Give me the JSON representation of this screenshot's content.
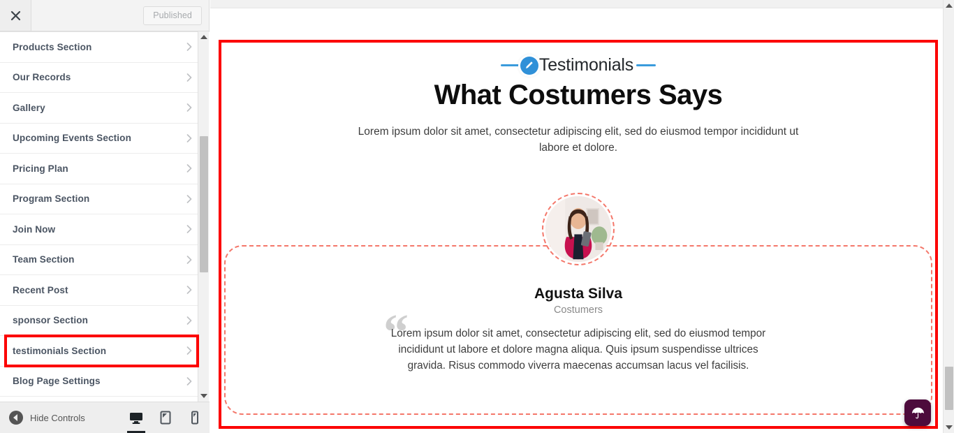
{
  "customizer": {
    "close_label": "Close",
    "publish_label": "Published",
    "sections": [
      {
        "label": "Products Section",
        "marked": false
      },
      {
        "label": "Our Records",
        "marked": false
      },
      {
        "label": "Gallery",
        "marked": false
      },
      {
        "label": "Upcoming Events Section",
        "marked": false
      },
      {
        "label": "Pricing Plan",
        "marked": false
      },
      {
        "label": "Program Section",
        "marked": false
      },
      {
        "label": "Join Now",
        "marked": false
      },
      {
        "label": "Team Section",
        "marked": false
      },
      {
        "label": "Recent Post",
        "marked": false
      },
      {
        "label": "sponsor Section",
        "marked": false
      },
      {
        "label": "testimonials Section",
        "marked": true
      },
      {
        "label": "Blog Page Settings",
        "marked": false
      }
    ],
    "footer": {
      "hide_controls_label": "Hide Controls",
      "devices": [
        {
          "name": "desktop",
          "active": true
        },
        {
          "name": "tablet",
          "active": false
        },
        {
          "name": "mobile",
          "active": false
        }
      ]
    }
  },
  "preview": {
    "testimonials": {
      "eyebrow": "Testimonials",
      "title": "What Costumers Says",
      "subtitle": "Lorem ipsum dolor sit amet, consectetur adipiscing elit, sed do eiusmod tempor incididunt ut labore et dolore.",
      "person_name": "Agusta Silva",
      "person_role": "Costumers",
      "quote_mark": "“",
      "quote": "Lorem ipsum dolor sit amet, consectetur adipiscing elit, sed do eiusmod tempor incididunt ut labore et dolore magna aliqua. Quis ipsum suspendisse ultrices gravida. Risus commodo viverra maecenas accumsan lacus vel facilisis."
    }
  },
  "colors": {
    "accent_blue": "#2f90d8",
    "dashed_border": "#f4776a",
    "annotation_red": "#fc0000",
    "fab_purple": "#4d0b3c",
    "sidebar_text": "#4b5563"
  }
}
